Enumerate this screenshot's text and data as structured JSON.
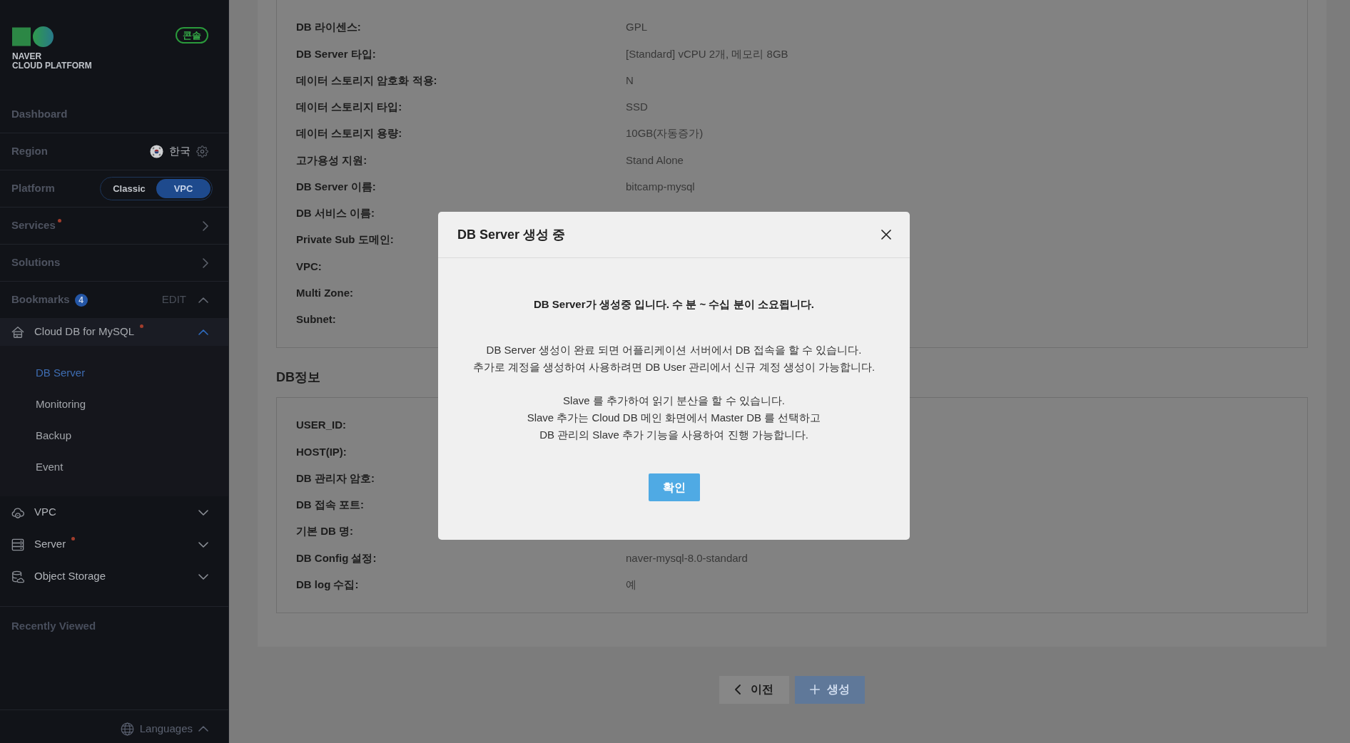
{
  "sidebar": {
    "logo": {
      "brand": "NAVER",
      "product": "CLOUD PLATFORM"
    },
    "console_button": "콘솔",
    "dashboard": "Dashboard",
    "region": {
      "label": "Region",
      "value": "한국"
    },
    "platform": {
      "label": "Platform",
      "options": [
        {
          "label": "Classic",
          "selected": false
        },
        {
          "label": "VPC",
          "selected": true
        }
      ]
    },
    "menus": [
      {
        "label": "Services",
        "new": true
      },
      {
        "label": "Solutions",
        "new": false
      }
    ],
    "bookmarks": {
      "label": "Bookmarks",
      "count": "4",
      "edit": "EDIT",
      "expanded": true,
      "items": [
        {
          "kind": "database",
          "label": "Cloud DB for MySQL",
          "new": true,
          "expanded": true,
          "children": [
            {
              "label": "DB Server",
              "selected": true
            },
            {
              "label": "Monitoring",
              "selected": false
            },
            {
              "label": "Backup",
              "selected": false
            },
            {
              "label": "Event",
              "selected": false
            }
          ]
        },
        {
          "kind": "network",
          "label": "VPC",
          "new": false,
          "expanded": false
        },
        {
          "kind": "server",
          "label": "Server",
          "new": true,
          "expanded": false
        },
        {
          "kind": "storage",
          "label": "Object Storage",
          "new": false,
          "expanded": false
        }
      ]
    },
    "recently_viewed": "Recently Viewed",
    "languages": "Languages"
  },
  "server_details": {
    "rows": [
      {
        "label": "DB 라이센스:",
        "value": "GPL"
      },
      {
        "label": "DB Server 타입:",
        "value": "[Standard] vCPU 2개, 메모리 8GB"
      },
      {
        "label": "데이터 스토리지 암호화 적용:",
        "value": "N"
      },
      {
        "label": "데이터 스토리지 타입:",
        "value": "SSD"
      },
      {
        "label": "데이터 스토리지 용량:",
        "value": "10GB(자동증가)"
      },
      {
        "label": "고가용성 지원:",
        "value": "Stand Alone"
      },
      {
        "label": "DB Server 이름:",
        "value": "bitcamp-mysql"
      },
      {
        "label": "DB 서비스 이름:"
      },
      {
        "label": "Private Sub 도메인:"
      },
      {
        "label": "VPC:"
      },
      {
        "label": "Multi Zone:"
      },
      {
        "label": "Subnet:"
      }
    ]
  },
  "db_info": {
    "title": "DB정보",
    "rows": [
      {
        "label": "USER_ID:"
      },
      {
        "label": "HOST(IP):"
      },
      {
        "label": "DB 관리자 암호:"
      },
      {
        "label": "DB 접속 포트:"
      },
      {
        "label": "기본 DB 명:"
      },
      {
        "label": "DB Config 설정:",
        "value": "naver-mysql-8.0-standard"
      },
      {
        "label": "DB log 수집:",
        "value": "예"
      }
    ]
  },
  "footer_buttons": [
    {
      "kind": "back",
      "label": "이전",
      "disabled": false
    },
    {
      "kind": "create",
      "label": "생성",
      "disabled": true
    }
  ],
  "modal": {
    "title": "DB Server 생성 중",
    "headline": "DB Server가 생성중 입니다. 수 분 ~ 수십 분이 소요됩니다.",
    "paragraphs": [
      {
        "lines": [
          "DB Server 생성이 완료 되면 어플리케이션 서버에서 DB 접속을 할 수 있습니다.",
          "추가로 계정을 생성하여 사용하려면 DB User 관리에서 신규 계정 생성이 가능합니다."
        ]
      },
      {
        "lines": [
          "Slave 를 추가하여 읽기 분산을 할 수 있습니다.",
          "Slave 추가는 Cloud DB 메인 화면에서 Master DB 를 선택하고",
          "DB 관리의 Slave 추가 기능을 사용하여 진행 가능합니다."
        ]
      }
    ],
    "confirm": "확인"
  }
}
